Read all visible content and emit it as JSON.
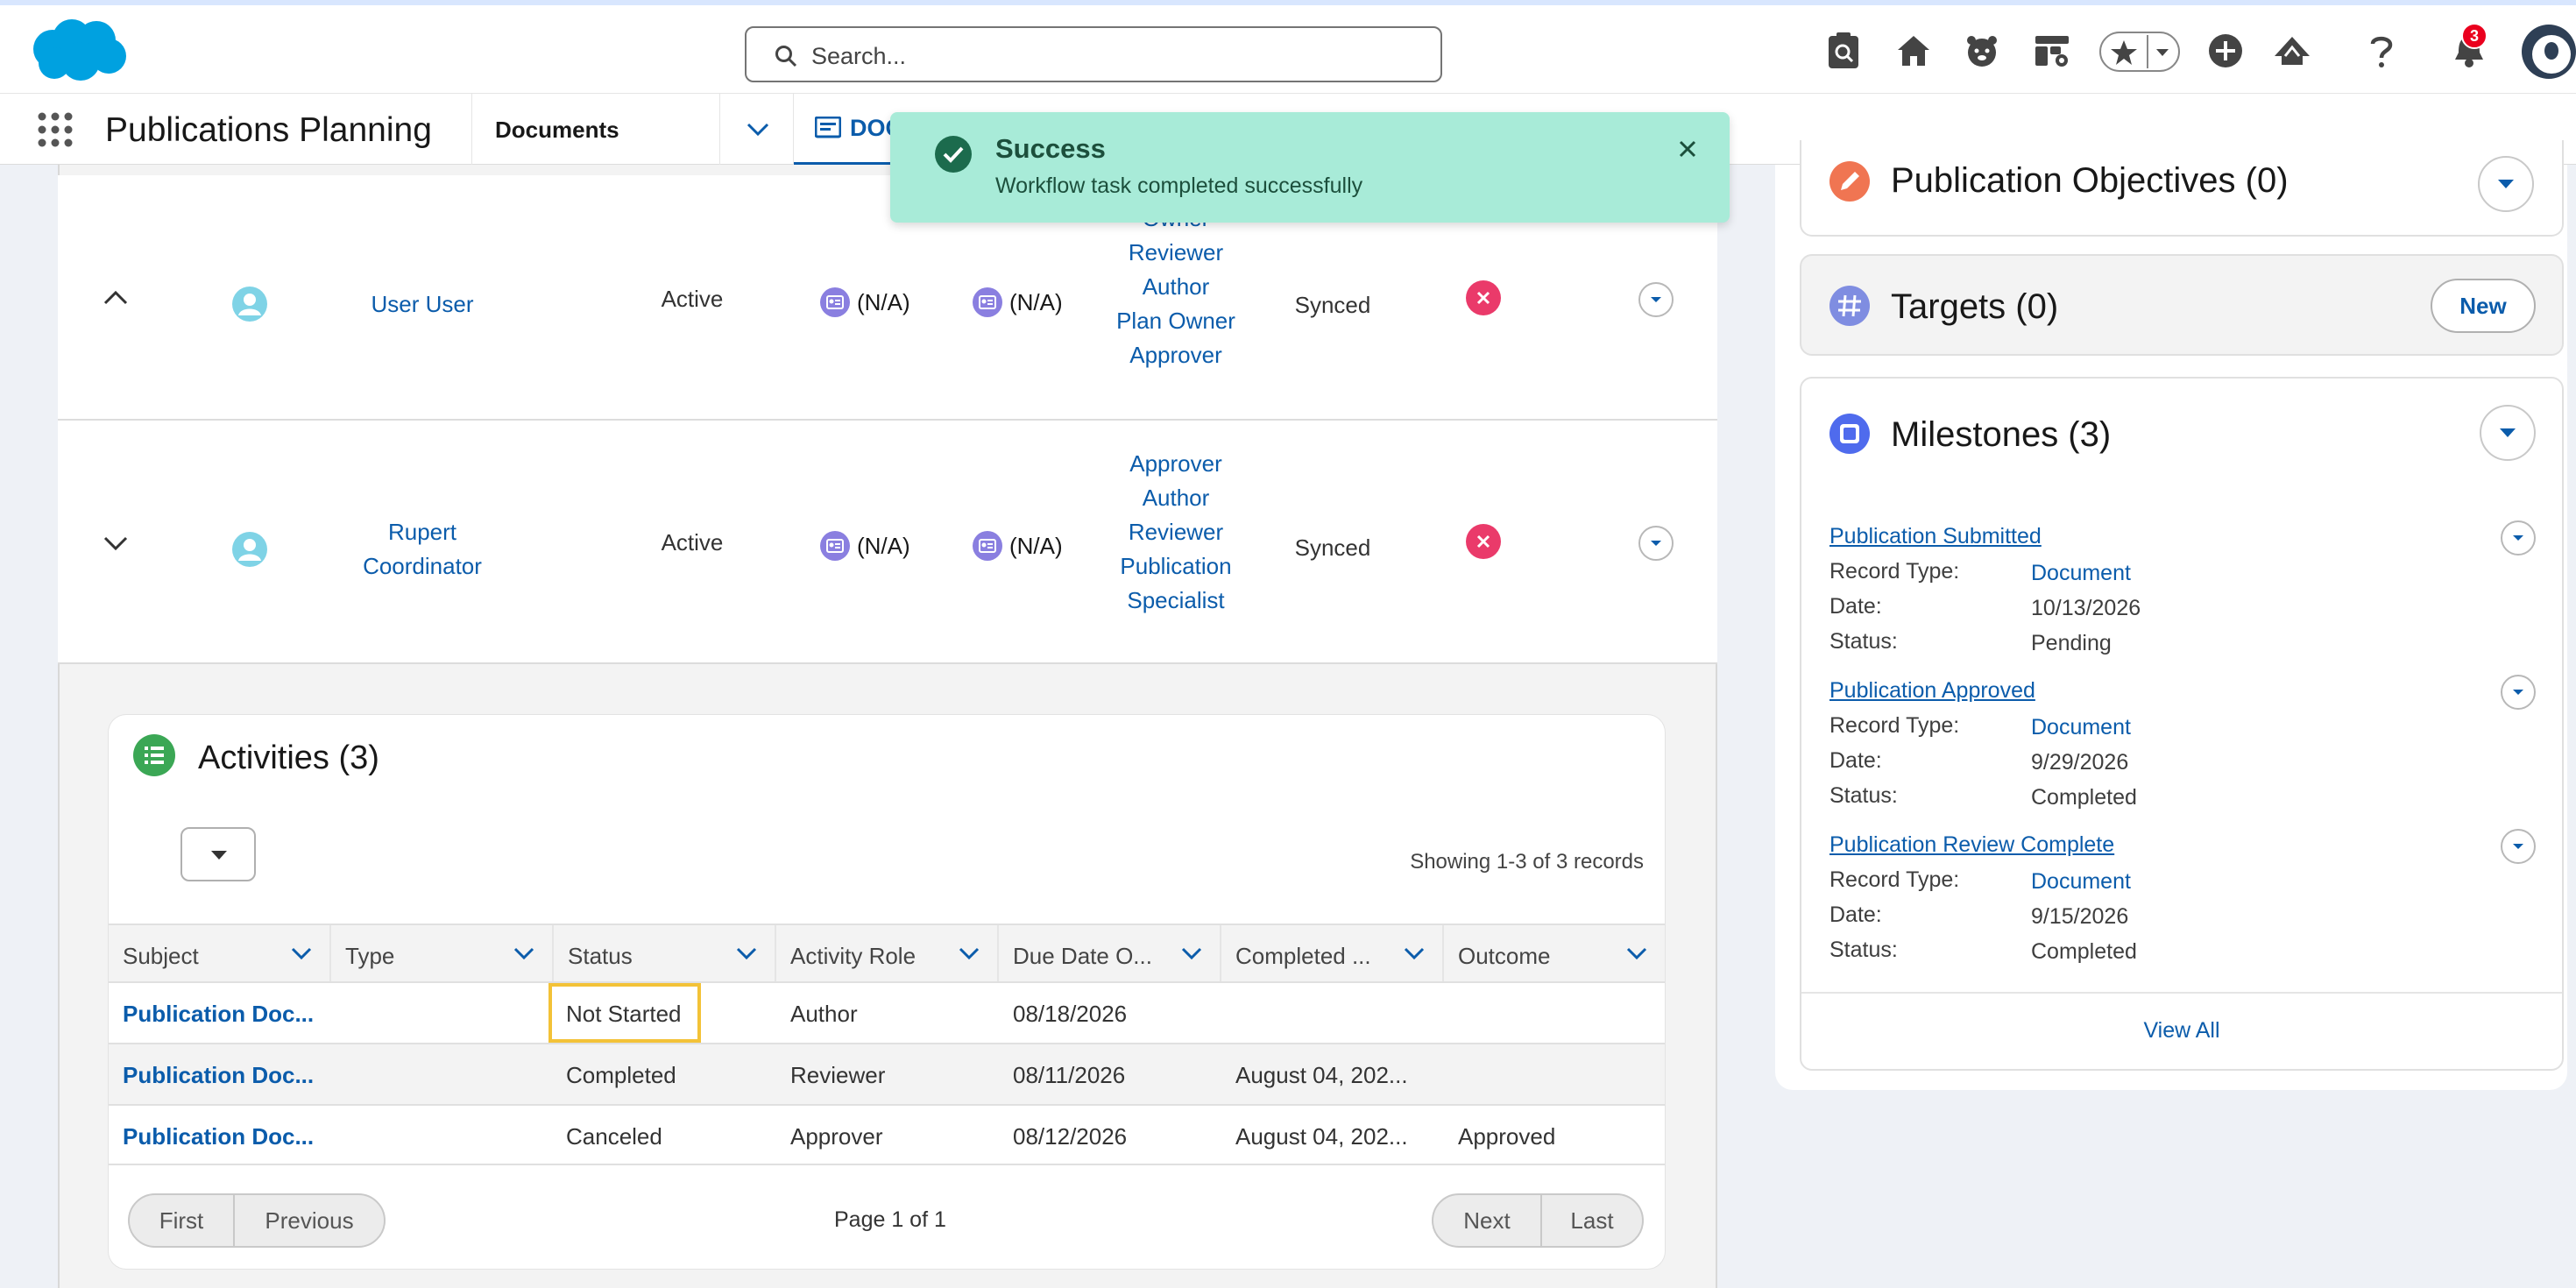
{
  "header": {
    "search_placeholder": "Search...",
    "notification_count": "3"
  },
  "nav": {
    "app_name": "Publications Planning",
    "documents_label": "Documents",
    "doc_tab_label": "DOC"
  },
  "toast": {
    "title": "Success",
    "message": "Workflow task completed successfully"
  },
  "members": [
    {
      "name": "User User",
      "status": "Active",
      "field1": "(N/A)",
      "field2": "(N/A)",
      "roles": [
        "Owner",
        "Reviewer",
        "Author",
        "Plan Owner",
        "Approver"
      ],
      "sync": "Synced"
    },
    {
      "name_line1": "Rupert",
      "name_line2": "Coordinator",
      "status": "Active",
      "field1": "(N/A)",
      "field2": "(N/A)",
      "roles": [
        "Approver",
        "Author",
        "Reviewer",
        "Publication",
        "Specialist"
      ],
      "sync": "Synced"
    }
  ],
  "activities": {
    "title": "Activities (3)",
    "showing": "Showing 1-3 of 3 records",
    "columns": [
      "Subject",
      "Type",
      "Status",
      "Activity Role",
      "Due Date O...",
      "Completed ...",
      "Outcome"
    ],
    "rows": [
      {
        "subject": "Publication Doc...",
        "type": "",
        "status": "Not Started",
        "role": "Author",
        "due": "08/18/2026",
        "completed": "",
        "outcome": ""
      },
      {
        "subject": "Publication Doc...",
        "type": "",
        "status": "Completed",
        "role": "Reviewer",
        "due": "08/11/2026",
        "completed": "August 04, 202...",
        "outcome": ""
      },
      {
        "subject": "Publication Doc...",
        "type": "",
        "status": "Canceled",
        "role": "Approver",
        "due": "08/12/2026",
        "completed": "August 04, 202...",
        "outcome": "Approved"
      }
    ],
    "pagination": {
      "first": "First",
      "previous": "Previous",
      "page_info": "Page 1 of 1",
      "next": "Next",
      "last": "Last"
    }
  },
  "right_panel": {
    "objectives_title": "Publication Objectives (0)",
    "targets_title": "Targets (0)",
    "targets_new_button": "New",
    "milestones_title": "Milestones (3)",
    "labels": {
      "record_type": "Record Type:",
      "date": "Date:",
      "status": "Status:"
    },
    "milestones": [
      {
        "name": "Publication Submitted",
        "record_type": "Document",
        "date": "10/13/2026",
        "status": "Pending"
      },
      {
        "name": "Publication Approved",
        "record_type": "Document",
        "date": "9/29/2026",
        "status": "Completed"
      },
      {
        "name": "Publication Review Complete",
        "record_type": "Document",
        "date": "9/15/2026",
        "status": "Completed"
      }
    ],
    "view_all": "View All"
  }
}
